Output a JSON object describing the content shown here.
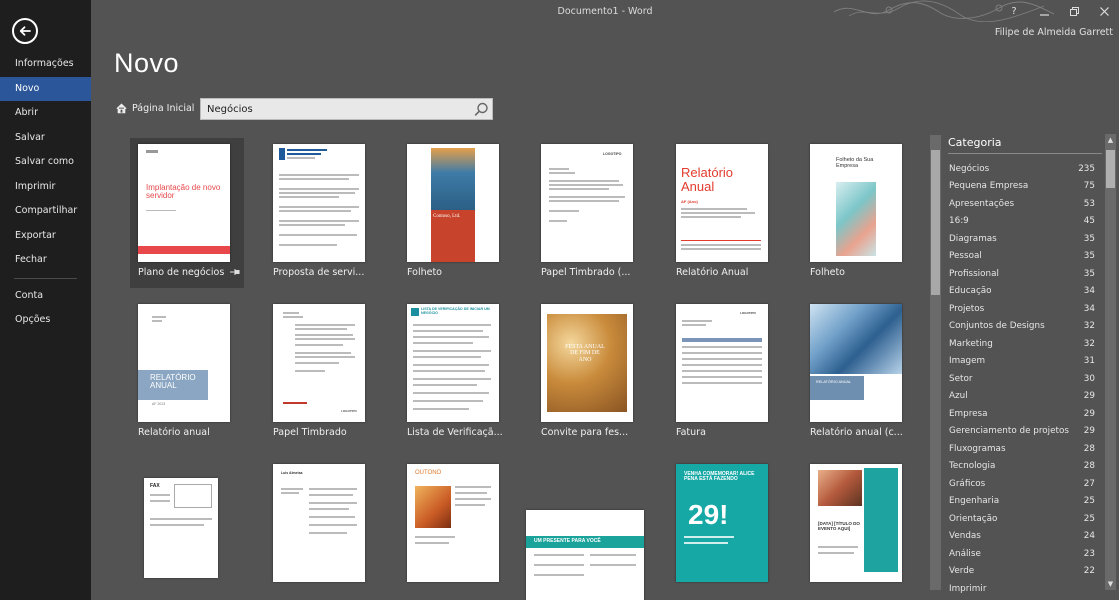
{
  "window": {
    "title": "Documento1 - Word",
    "help_label": "?",
    "user": "Filipe de Almeida Garrett"
  },
  "nav": {
    "items": [
      {
        "label": "Informações"
      },
      {
        "label": "Novo"
      },
      {
        "label": "Abrir"
      },
      {
        "label": "Salvar"
      },
      {
        "label": "Salvar como"
      },
      {
        "label": "Imprimir"
      },
      {
        "label": "Compartilhar"
      },
      {
        "label": "Exportar"
      },
      {
        "label": "Fechar"
      },
      {
        "label": "Conta"
      },
      {
        "label": "Opções"
      }
    ],
    "active": "Novo"
  },
  "page": {
    "title": "Novo",
    "home_label": "Página Inicial",
    "search_value": "Negócios"
  },
  "templates": [
    {
      "label": "Plano de negócios",
      "thumb_title": "Implantação de novo servidor",
      "accent": "#e8484a"
    },
    {
      "label": "Proposta de servi...",
      "accent": "#1f5b9a"
    },
    {
      "label": "Folheto",
      "thumb_title": "Contoso, Ltd.",
      "accent": "#c8432b"
    },
    {
      "label": "Papel Timbrado (...",
      "thumb_title": "LOGOTIPO"
    },
    {
      "label": "Relatório Anual",
      "thumb_title": "Relatório Anual",
      "thumb_sub": "AF (Ano)",
      "accent": "#e23b2e"
    },
    {
      "label": "Folheto",
      "thumb_title": "Folheto da Sua Empresa",
      "accent": "#5cb7b8"
    },
    {
      "label": "Relatório anual",
      "thumb_title": "RELATÓRIO ANUAL",
      "thumb_sub": "AF 2013",
      "accent": "#8aa6c2"
    },
    {
      "label": "Papel Timbrado",
      "thumb_title": "LOGOTIPO",
      "accent": "#c0392b"
    },
    {
      "label": "Lista de Verificaçã...",
      "thumb_title": "LISTA DE VERIFICAÇÃO DE INICIAR UM NEGÓCIO",
      "accent": "#1b8fa0"
    },
    {
      "label": "Convite para fes...",
      "thumb_title": "FESTA ANUAL DE FIM DE ANO",
      "accent": "#c98b3b"
    },
    {
      "label": "Fatura",
      "thumb_title": "LOGOTIPO",
      "accent": "#7a95b8"
    },
    {
      "label": "Relatório anual (c...",
      "thumb_title": "RELATÓRIO ANUAL",
      "accent": "#6f8fb0"
    },
    {
      "label": "",
      "thumb_title": "FAX"
    },
    {
      "label": "",
      "thumb_title": "Luis Almeisa"
    },
    {
      "label": "",
      "thumb_title": "OUTONO",
      "accent": "#e07a2e"
    },
    {
      "label": "",
      "thumb_title": "UM PRESENTE PARA VOCÊ",
      "accent": "#1aa39a"
    },
    {
      "label": "",
      "thumb_title": "VENHA COMEMORAR! ALICE PENA ESTÁ FAZENDO",
      "thumb_sub": "29!",
      "accent": "#16a8a5"
    },
    {
      "label": "",
      "thumb_title": "[DATA] [TÍTULO DO EVENTO AQUI]",
      "accent": "#1fa3a0"
    }
  ],
  "category": {
    "title": "Categoria",
    "items": [
      {
        "name": "Negócios",
        "count": "235"
      },
      {
        "name": "Pequena Empresa",
        "count": "75"
      },
      {
        "name": "Apresentações",
        "count": "53"
      },
      {
        "name": "16:9",
        "count": "45"
      },
      {
        "name": "Diagramas",
        "count": "35"
      },
      {
        "name": "Pessoal",
        "count": "35"
      },
      {
        "name": "Profissional",
        "count": "35"
      },
      {
        "name": "Educação",
        "count": "34"
      },
      {
        "name": "Projetos",
        "count": "34"
      },
      {
        "name": "Conjuntos de Designs",
        "count": "32"
      },
      {
        "name": "Marketing",
        "count": "32"
      },
      {
        "name": "Imagem",
        "count": "31"
      },
      {
        "name": "Setor",
        "count": "30"
      },
      {
        "name": "Azul",
        "count": "29"
      },
      {
        "name": "Empresa",
        "count": "29"
      },
      {
        "name": "Gerenciamento de projetos",
        "count": "29"
      },
      {
        "name": "Fluxogramas",
        "count": "28"
      },
      {
        "name": "Tecnologia",
        "count": "28"
      },
      {
        "name": "Gráficos",
        "count": "27"
      },
      {
        "name": "Engenharia",
        "count": "25"
      },
      {
        "name": "Orientação",
        "count": "25"
      },
      {
        "name": "Vendas",
        "count": "24"
      },
      {
        "name": "Análise",
        "count": "23"
      },
      {
        "name": "Verde",
        "count": "22"
      },
      {
        "name": "Imprimir",
        "count": ""
      }
    ]
  },
  "colors": {
    "nav_bg": "#1e1e1e",
    "nav_active": "#2b579a",
    "content_bg": "#535353"
  }
}
